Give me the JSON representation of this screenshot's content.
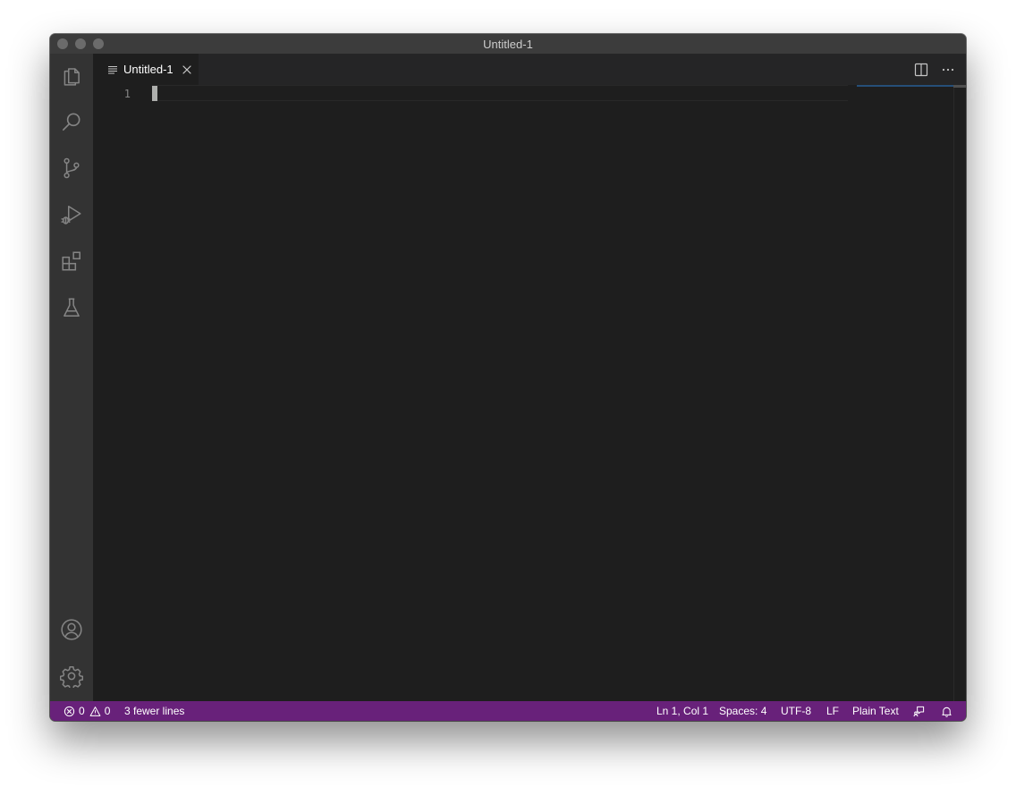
{
  "window": {
    "title": "Untitled-1"
  },
  "activity_bar": {
    "top_items": [
      {
        "icon": "files-icon",
        "label": "Explorer"
      },
      {
        "icon": "search-icon",
        "label": "Search"
      },
      {
        "icon": "source-control-icon",
        "label": "Source Control"
      },
      {
        "icon": "run-debug-icon",
        "label": "Run and Debug"
      },
      {
        "icon": "extensions-icon",
        "label": "Extensions"
      },
      {
        "icon": "testing-icon",
        "label": "Testing"
      }
    ],
    "bottom_items": [
      {
        "icon": "accounts-icon",
        "label": "Accounts"
      },
      {
        "icon": "gear-icon",
        "label": "Manage"
      }
    ]
  },
  "tabs": [
    {
      "label": "Untitled-1",
      "icon": "plain-text-file-icon",
      "active": true
    }
  ],
  "editor": {
    "line_numbers": [
      "1"
    ],
    "content": ""
  },
  "status_bar": {
    "errors": "0",
    "warnings": "0",
    "message": "3 fewer lines",
    "position": "Ln 1, Col 1",
    "indentation": "Spaces: 4",
    "encoding": "UTF-8",
    "eol": "LF",
    "language": "Plain Text",
    "icons": [
      "error-icon",
      "warning-icon",
      "feedback-icon",
      "bell-icon"
    ]
  },
  "colors": {
    "status_bar": "#68217a",
    "activity_bar": "#333333",
    "editor_bg": "#1e1e1e",
    "titlebar": "#3c3c3c",
    "tab_bar": "#252526"
  }
}
